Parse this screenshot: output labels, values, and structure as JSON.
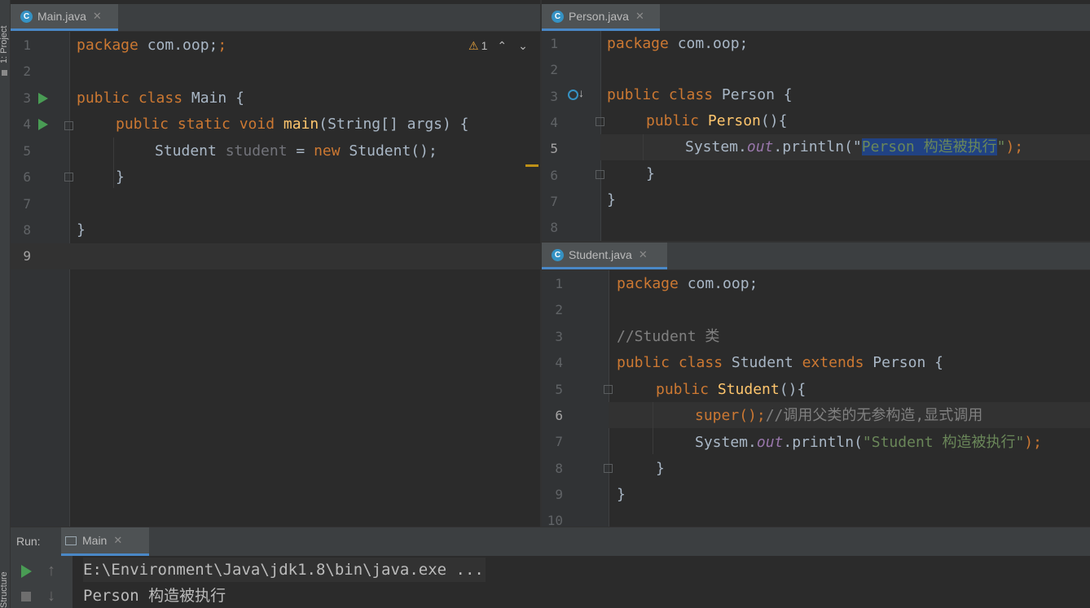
{
  "sidebar": {
    "project_label": "1: Project",
    "structure_label": "Structure"
  },
  "editors": {
    "main": {
      "tab": "Main.java",
      "inspection": {
        "count": "1"
      },
      "line_numbers": [
        "1",
        "2",
        "3",
        "4",
        "5",
        "6",
        "7",
        "8",
        "9"
      ],
      "lines": {
        "l1": {
          "kw": "package",
          "rest": " com.oop;"
        },
        "l3": {
          "kw": "public class",
          "rest": " Main {"
        },
        "l4": {
          "kw": "public static void",
          "fn": "main",
          "rest": "(String[] args) {"
        },
        "l5": {
          "type": "Student",
          "var": "student",
          "eq": " = ",
          "kw": "new",
          "rest": " Student();"
        },
        "l6": {
          "text": "}"
        },
        "l8": {
          "text": "}"
        }
      }
    },
    "person": {
      "tab": "Person.java",
      "line_numbers": [
        "1",
        "2",
        "3",
        "4",
        "5",
        "6",
        "7",
        "8"
      ],
      "lines": {
        "l1": {
          "kw": "package",
          "rest": " com.oop;"
        },
        "l3": {
          "kw": "public class",
          "rest": " Person {"
        },
        "l4": {
          "kw": "public",
          "fn": "Person",
          "rest": "(){"
        },
        "l5": {
          "pre": "System.",
          "static": "out",
          "mid": ".println(\"",
          "selected": "Person 构造被执行",
          "post": "\");"
        },
        "l6": {
          "text": "}"
        },
        "l7": {
          "text": "}"
        }
      }
    },
    "student": {
      "tab": "Student.java",
      "line_numbers": [
        "1",
        "2",
        "3",
        "4",
        "5",
        "6",
        "7",
        "8",
        "9",
        "10"
      ],
      "lines": {
        "l1": {
          "kw": "package",
          "rest": " com.oop;"
        },
        "l3": {
          "comment": "//Student 类"
        },
        "l4": {
          "kw": "public class",
          "name": " Student ",
          "kw2": "extends",
          "rest": " Person {"
        },
        "l5": {
          "kw": "public",
          "fn": "Student",
          "rest": "(){"
        },
        "l6": {
          "kw": "super",
          "rest": "();",
          "comment": "//调用父类的无参构造,显式调用"
        },
        "l7": {
          "pre": "System.",
          "static": "out",
          "mid": ".println(",
          "str": "\"Student 构造被执行\"",
          "post": ");"
        },
        "l8": {
          "text": "}"
        },
        "l9": {
          "text": "}"
        }
      }
    }
  },
  "run_panel": {
    "label": "Run:",
    "tab": "Main",
    "output": [
      "E:\\Environment\\Java\\jdk1.8\\bin\\java.exe ...",
      "Person 构造被执行"
    ]
  },
  "colors": {
    "keyword": "#cc7832",
    "function": "#ffc66d",
    "string": "#6a8759",
    "run": "#499c54",
    "selection": "#214283"
  }
}
